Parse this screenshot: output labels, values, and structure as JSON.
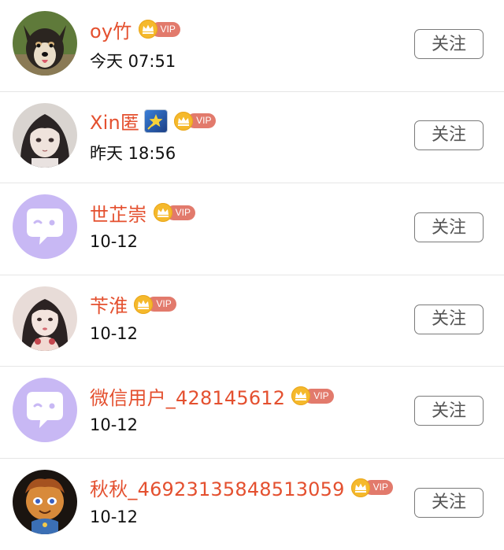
{
  "users": [
    {
      "name": "oy竹",
      "time": "今天 07:51",
      "vip_label": "VIP",
      "follow_label": "关注",
      "avatar": "dog-photo",
      "emoji": null
    },
    {
      "name": "Xin匿",
      "time": "昨天 18:56",
      "vip_label": "VIP",
      "follow_label": "关注",
      "avatar": "anime-girl",
      "emoji": "star-emoji"
    },
    {
      "name": "世芷崇",
      "time": "10-12",
      "vip_label": "VIP",
      "follow_label": "关注",
      "avatar": "default-chat-bubble",
      "emoji": null
    },
    {
      "name": "苄淮",
      "time": "10-12",
      "vip_label": "VIP",
      "follow_label": "关注",
      "avatar": "girl-photo",
      "emoji": null
    },
    {
      "name": "微信用户_428145612",
      "time": "10-12",
      "vip_label": "VIP",
      "follow_label": "关注",
      "avatar": "default-chat-bubble",
      "emoji": null
    },
    {
      "name": "秋秋_46923135848513059",
      "time": "10-12",
      "vip_label": "VIP",
      "follow_label": "关注",
      "avatar": "cartoon-character",
      "emoji": null
    }
  ],
  "colors": {
    "name": "#e4502f",
    "vip_badge": "#e27a6c",
    "crown": "#f5b92c",
    "default_avatar": "#c8b8f4",
    "divider": "#e6e6e6"
  }
}
